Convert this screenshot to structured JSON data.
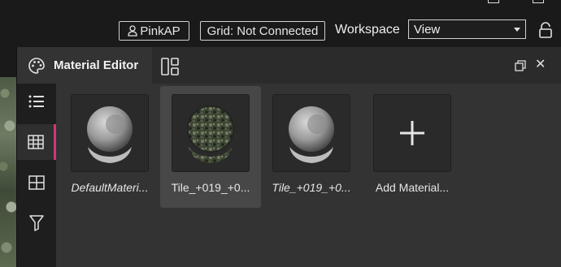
{
  "topbar": {
    "user_label": "PinkAP",
    "grid_status": "Grid: Not Connected",
    "workspace_label": "Workspace",
    "workspace_value": "View"
  },
  "panel": {
    "title": "Material Editor",
    "accent_color": "#d6337a"
  },
  "sidebar": {
    "items": [
      {
        "icon": "list-icon",
        "active": false
      },
      {
        "icon": "grid-icon",
        "active": true
      },
      {
        "icon": "tile-icon",
        "active": false
      },
      {
        "icon": "filter-icon",
        "active": false
      }
    ]
  },
  "materials": [
    {
      "label": "DefaultMateri...",
      "preview": "gray-sphere",
      "italic": true,
      "selected": false
    },
    {
      "label": "Tile_+019_+0...",
      "preview": "textured-sphere",
      "italic": false,
      "selected": true
    },
    {
      "label": "Tile_+019_+0...",
      "preview": "gray-sphere",
      "italic": true,
      "selected": false
    },
    {
      "label": "Add Material...",
      "preview": "plus-icon",
      "italic": false,
      "selected": false
    }
  ]
}
